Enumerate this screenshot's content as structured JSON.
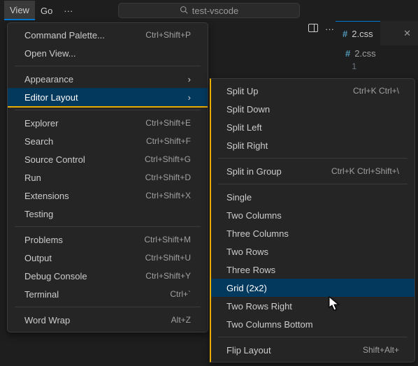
{
  "titlebar": {
    "menu_view": "View",
    "menu_go": "Go",
    "search_label": "test-vscode"
  },
  "editor": {
    "tab_label": "2.css",
    "breadcrumb_label": "2.css",
    "line_number": "1"
  },
  "view_menu": {
    "command_palette": "Command Palette...",
    "command_palette_kbd": "Ctrl+Shift+P",
    "open_view": "Open View...",
    "appearance": "Appearance",
    "editor_layout": "Editor Layout",
    "explorer": "Explorer",
    "explorer_kbd": "Ctrl+Shift+E",
    "search": "Search",
    "search_kbd": "Ctrl+Shift+F",
    "source_control": "Source Control",
    "source_control_kbd": "Ctrl+Shift+G",
    "run": "Run",
    "run_kbd": "Ctrl+Shift+D",
    "extensions": "Extensions",
    "extensions_kbd": "Ctrl+Shift+X",
    "testing": "Testing",
    "problems": "Problems",
    "problems_kbd": "Ctrl+Shift+M",
    "output": "Output",
    "output_kbd": "Ctrl+Shift+U",
    "debug_console": "Debug Console",
    "debug_console_kbd": "Ctrl+Shift+Y",
    "terminal": "Terminal",
    "terminal_kbd": "Ctrl+`",
    "word_wrap": "Word Wrap",
    "word_wrap_kbd": "Alt+Z"
  },
  "layout_submenu": {
    "split_up": "Split Up",
    "split_up_kbd": "Ctrl+K Ctrl+\\",
    "split_down": "Split Down",
    "split_left": "Split Left",
    "split_right": "Split Right",
    "split_in_group": "Split in Group",
    "split_in_group_kbd": "Ctrl+K Ctrl+Shift+\\",
    "single": "Single",
    "two_columns": "Two Columns",
    "three_columns": "Three Columns",
    "two_rows": "Two Rows",
    "three_rows": "Three Rows",
    "grid_2x2": "Grid (2x2)",
    "two_rows_right": "Two Rows Right",
    "two_columns_bottom": "Two Columns Bottom",
    "flip_layout": "Flip Layout",
    "flip_layout_kbd": "Shift+Alt+"
  }
}
